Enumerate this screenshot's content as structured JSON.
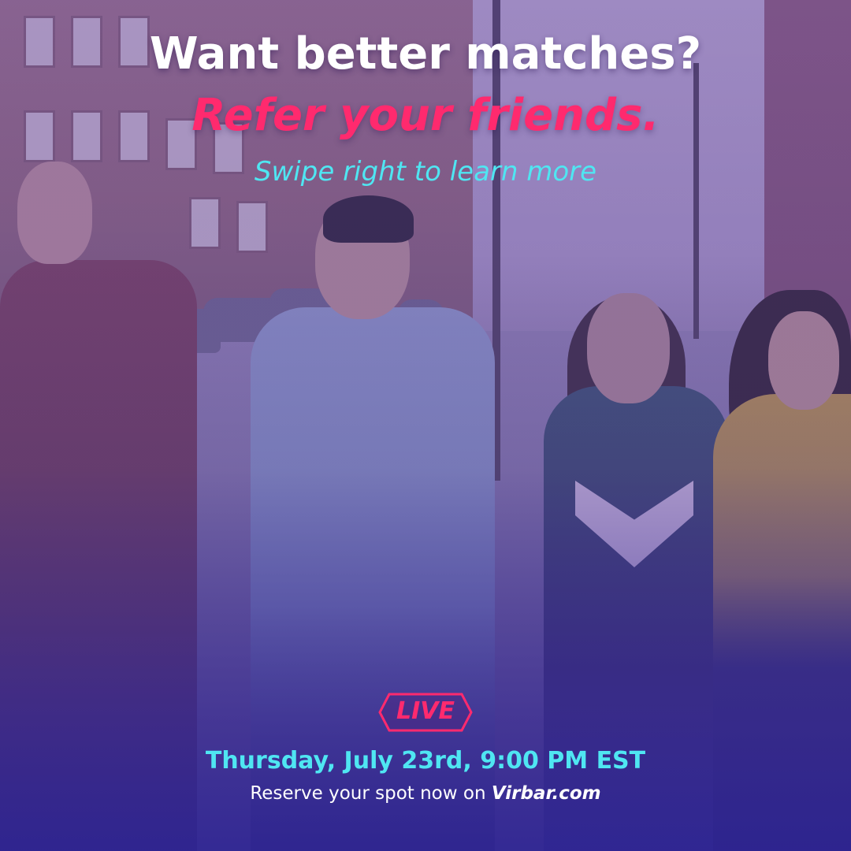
{
  "headline": "Want better matches?",
  "subheadline": "Refer your friends.",
  "swipe_prompt": "Swipe right to learn more",
  "live_badge": "LIVE",
  "event_date": "Thursday, July 23rd, 9:00 PM EST",
  "reserve": {
    "prefix": "Reserve your spot now on ",
    "site": "Virbar.com"
  },
  "colors": {
    "accent_pink": "#ff2a6e",
    "accent_cyan": "#4fe6f2",
    "overlay_purple": "#3a2c96"
  }
}
